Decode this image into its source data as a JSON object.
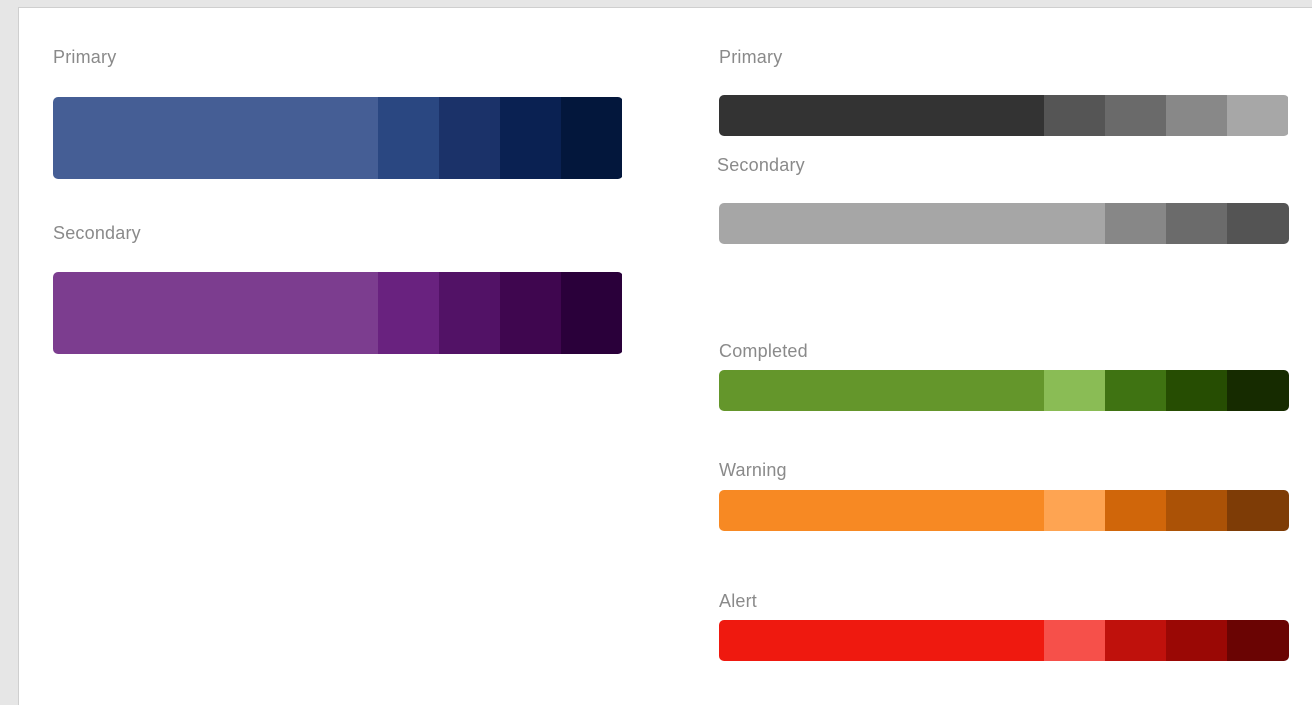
{
  "palettes": [
    {
      "id": "left-primary",
      "label": "Primary",
      "main": "#455e95",
      "shades": [
        "#2a4781",
        "#1b3269",
        "#0a2152",
        "#03173c"
      ]
    },
    {
      "id": "left-secondary",
      "label": "Secondary",
      "main": "#7c3d8f",
      "shades": [
        "#69227f",
        "#521266",
        "#3f064f",
        "#2a003a"
      ]
    },
    {
      "id": "right-primary",
      "label": "Primary",
      "main": "#333333",
      "shades": [
        "#555555",
        "#6a6a6a",
        "#888888",
        "#a7a7a7"
      ]
    },
    {
      "id": "right-secondary",
      "label": "Secondary",
      "main": "#a6a6a6",
      "shades": [
        "#878787",
        "#6b6b6b",
        "#545454"
      ]
    },
    {
      "id": "completed",
      "label": "Completed",
      "main": "#64962b",
      "shades": [
        "#8abc55",
        "#3f7312",
        "#264d02",
        "#162b00"
      ]
    },
    {
      "id": "warning",
      "label": "Warning",
      "main": "#f78923",
      "shades": [
        "#fea452",
        "#d0660a",
        "#ab5206",
        "#7e3c06"
      ]
    },
    {
      "id": "alert",
      "label": "Alert",
      "main": "#ef190f",
      "shades": [
        "#f6504a",
        "#bf110c",
        "#9a0805",
        "#6a0403"
      ]
    }
  ]
}
